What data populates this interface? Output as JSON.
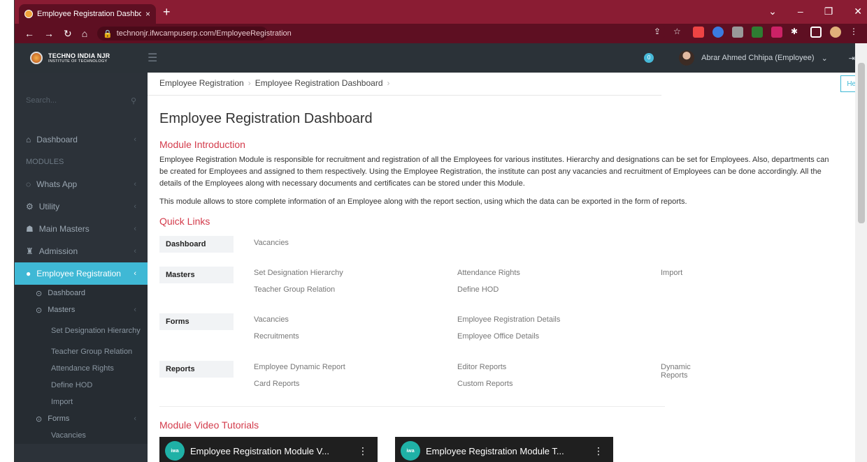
{
  "browser": {
    "tab_title": "Employee Registration Dashboar",
    "close": "×",
    "newtab": "+",
    "url": "technonjr.ifwcampuserp.com/EmployeeRegistration"
  },
  "app": {
    "logo_line1": "TECHNO INDIA NJR",
    "logo_line2": "INSTITUTE OF TECHNOLOGY",
    "notif_count": "0",
    "user": "Abrar Ahmed Chhipa (Employee)"
  },
  "sidebar": {
    "search_placeholder": "Search...",
    "dashboard": "Dashboard",
    "modules_heading": "MODULES",
    "items": [
      "Whats App",
      "Utility",
      "Main Masters",
      "Admission"
    ],
    "active": "Employee Registration",
    "sub": {
      "dashboard": "Dashboard",
      "masters": "Masters",
      "masters_items": [
        "Set Designation Hierarchy",
        "Teacher Group Relation",
        "Attendance Rights",
        "Define HOD",
        "Import"
      ],
      "forms": "Forms",
      "forms_items": [
        "Vacancies"
      ]
    }
  },
  "breadcrumb": [
    "Employee Registration",
    "Employee Registration Dashboard"
  ],
  "help_label": "Help ▾",
  "page_title": "Employee Registration Dashboard",
  "module_intro": {
    "heading": "Module Introduction",
    "para1": "Employee Registration Module is responsible for recruitment and registration of all the Employees for various institutes. Hierarchy and designations can be set for Employees. Also, departments can be created for Employees and assigned to them respectively. Using the Employee Registration, the institute can post any vacancies and recruitment of Employees can be done accordingly. All the details of the Employees along with necessary documents and certificates can be stored under this Module.",
    "para2": "This module allows to store complete information of an Employee along with the report section, using which the data can be exported in the form of reports."
  },
  "quick_links": {
    "heading": "Quick Links",
    "rows": [
      {
        "label": "Dashboard",
        "links": [
          "Vacancies"
        ]
      },
      {
        "label": "Masters",
        "links": [
          "Set Designation Hierarchy",
          "Attendance Rights",
          "Import",
          "Teacher Group Relation",
          "Define HOD"
        ]
      },
      {
        "label": "Forms",
        "links": [
          "Vacancies",
          "Employee Registration Details",
          "Recruitments",
          "Employee Office Details"
        ]
      },
      {
        "label": "Reports",
        "links": [
          "Employee Dynamic Report",
          "Editor Reports",
          "Dynamic Reports",
          "Card Reports",
          "Custom Reports"
        ]
      }
    ]
  },
  "videos": {
    "heading": "Module Video Tutorials",
    "items": [
      "Employee Registration Module V...",
      "Employee Registration Module T..."
    ],
    "channel_badge": "iwa"
  }
}
